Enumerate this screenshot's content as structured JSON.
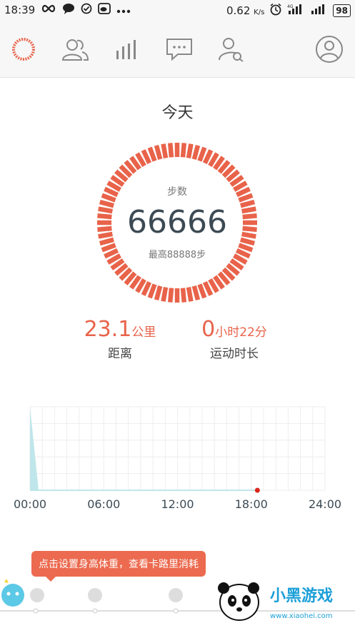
{
  "status_bar": {
    "time": "18:39",
    "network_speed": "0.62",
    "speed_unit": "K/s",
    "battery": "98"
  },
  "nav": {
    "items": [
      "activity-ring-icon",
      "friends-icon",
      "stats-icon",
      "messages-icon",
      "user-search-icon",
      "profile-icon"
    ],
    "accent": "#e8634a"
  },
  "today": {
    "title": "今天",
    "ring_label": "步数",
    "steps": "66666",
    "best": "最高88888步"
  },
  "stats": {
    "distance_value": "23.1",
    "distance_unit": "公里",
    "distance_label": "距离",
    "duration_hours": "0",
    "duration_hours_unit": "小时",
    "duration_minutes": "22",
    "duration_minutes_unit": "分",
    "duration_label": "运动时长"
  },
  "chart_data": {
    "type": "area",
    "x_ticks": [
      "00:00",
      "06:00",
      "12:00",
      "18:00",
      "24:00"
    ],
    "x_hours": [
      0,
      0.7,
      1.1,
      18.5
    ],
    "activity_level": [
      1.0,
      0.0,
      0.0,
      0.0
    ],
    "current_marker_hour": 18.5,
    "fill_color": "#bfe6ea",
    "marker_color": "#d9261c",
    "grid": true
  },
  "tooltip": {
    "text": "点击设置身高体重，查看卡路里消耗"
  },
  "watermark": {
    "brand": "小黑游戏",
    "url": "www.xiaohei.com"
  }
}
